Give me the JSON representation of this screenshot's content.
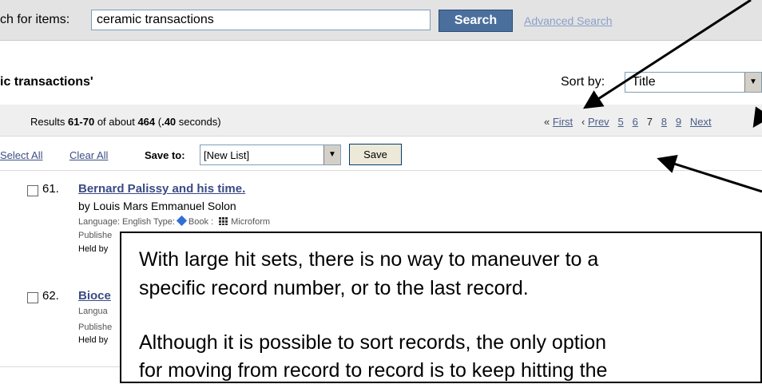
{
  "search": {
    "label": "ch for items:",
    "value": "ceramic transactions",
    "button": "Search",
    "advanced": "Advanced Search"
  },
  "results_header": {
    "title": "ic transactions'",
    "sort_label": "Sort by:",
    "sort_value": "Title"
  },
  "summary": {
    "prefix": "Results ",
    "range": "61-70",
    "mid": " of about ",
    "total": "464",
    "time_prefix": " (",
    "time": ".40",
    "time_suffix": " seconds)"
  },
  "pager": {
    "first": "First",
    "prev": "Prev",
    "pages": [
      "5",
      "6",
      "7",
      "8",
      "9"
    ],
    "current": "7",
    "next": "Next"
  },
  "controls": {
    "select_all": "Select All",
    "clear_all": "Clear All",
    "save_to": "Save to:",
    "list_value": "[New List]",
    "save": "Save"
  },
  "records": [
    {
      "number": "61.",
      "title": "Bernard Palissy and his time.",
      "by": "by Louis Mars Emmanuel Solon",
      "lang_line": "Language: English  Type:",
      "type1": "Book",
      "type2": "Microform",
      "published": "Publishe",
      "held": "Held by"
    },
    {
      "number": "62.",
      "title": "Bioce",
      "lang_line": "Langua",
      "published": "Publishe",
      "held": "Held by"
    }
  ],
  "callout": {
    "line1": "With large hit sets, there is no way to maneuver to a",
    "line2": "specific record number, or to the last record.",
    "line3": "Although it is possible to sort records, the only option",
    "line4": "for moving from record to record is to keep hitting the"
  },
  "colors": {
    "search_button": "#4b6f9c",
    "link": "#3a4b85",
    "top_bar": "#e3e3e3"
  }
}
